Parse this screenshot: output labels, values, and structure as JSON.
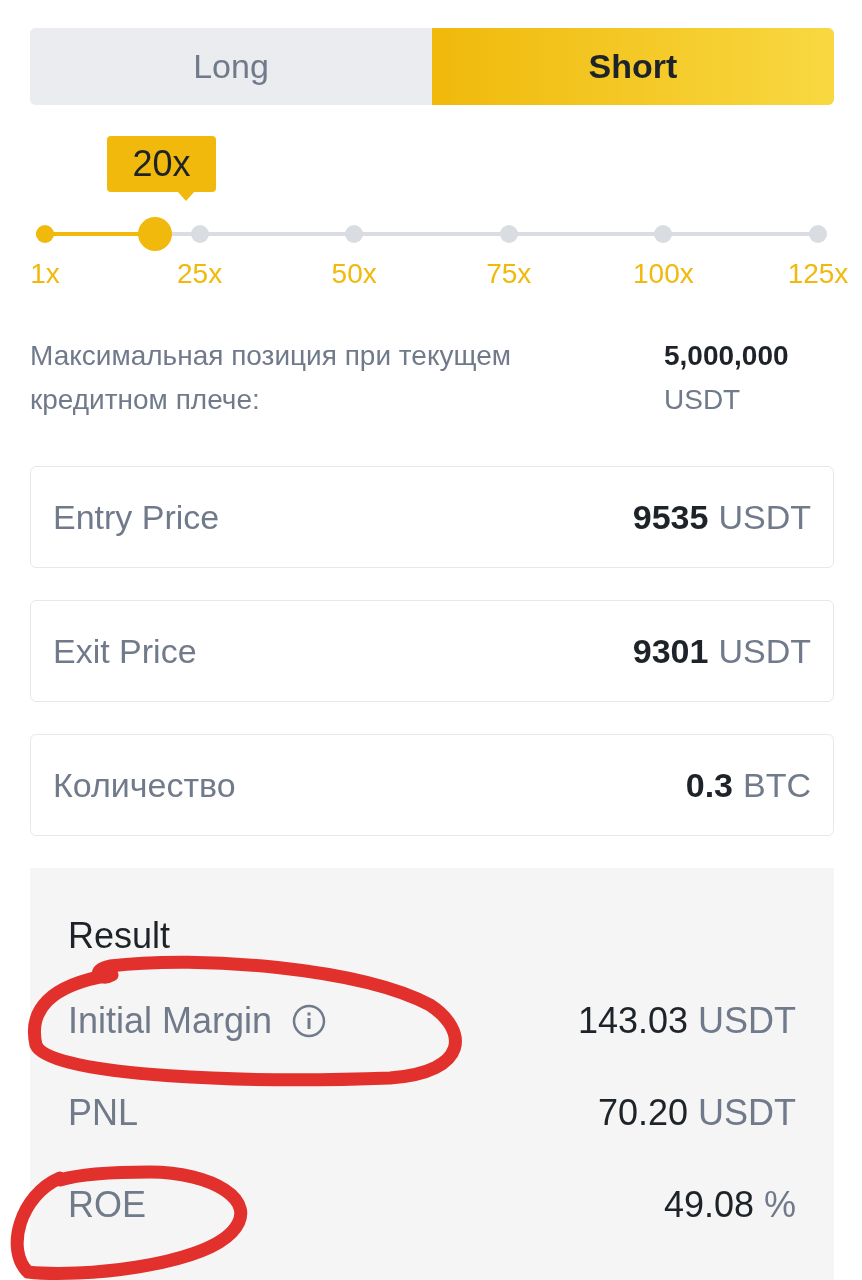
{
  "side_toggle": [
    {
      "label": "Long",
      "selected": false
    },
    {
      "label": "Short",
      "selected": true
    }
  ],
  "leverage": {
    "tooltip": "20x",
    "level": 0.15,
    "ticks": [
      "1x",
      "25x",
      "50x",
      "75x",
      "100x",
      "125x"
    ]
  },
  "max_position": {
    "label": "Максимальная позиция при текущем кредитном плече:",
    "value": "5,000,000",
    "unit": "USDT"
  },
  "fields": [
    {
      "label": "Entry Price",
      "value": "9535",
      "unit": "USDT"
    },
    {
      "label": "Exit Price",
      "value": "9301",
      "unit": "USDT"
    },
    {
      "label": "Количество",
      "value": "0.3",
      "unit": "BTC"
    }
  ],
  "result": {
    "title": "Result",
    "rows": [
      {
        "label": "Initial Margin",
        "info": true,
        "value": "143.03",
        "unit": "USDT"
      },
      {
        "label": "PNL",
        "info": false,
        "value": "70.20",
        "unit": "USDT"
      },
      {
        "label": "ROE",
        "info": false,
        "value": "49.08",
        "unit": "%"
      }
    ]
  }
}
